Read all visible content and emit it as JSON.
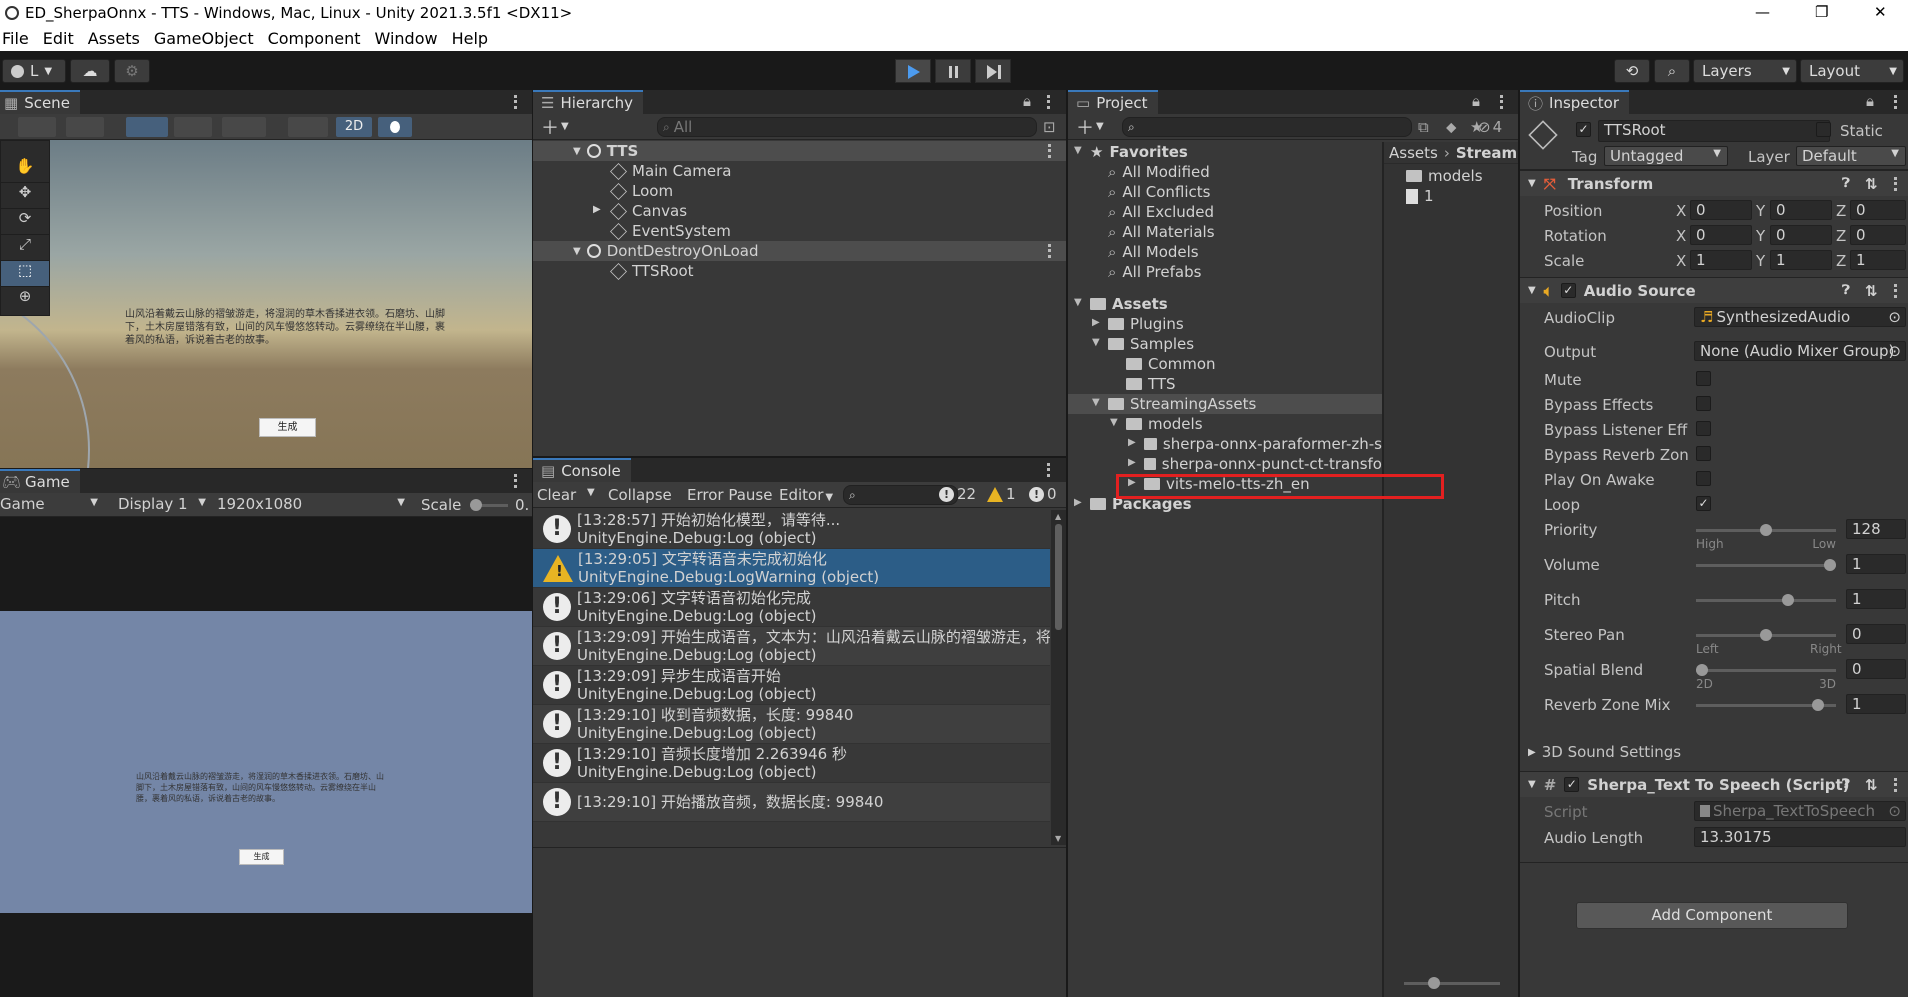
{
  "window": {
    "title": "ED_SherpaOnnx - TTS - Windows, Mac, Linux - Unity 2021.3.5f1 <DX11>",
    "minimize": "—",
    "restore": "❐",
    "close": "✕"
  },
  "menu": [
    "File",
    "Edit",
    "Assets",
    "GameObject",
    "Component",
    "Window",
    "Help"
  ],
  "toolbar": {
    "account": "L",
    "layers": "Layers",
    "layout": "Layout",
    "play": "play-icon",
    "pause": "pause-icon",
    "step": "step-icon"
  },
  "scene": {
    "tab": "Scene",
    "mode_2d": "2D",
    "text": "山风沿着戴云山脉的褶皱游走，将湿润的草木香揉进衣领。石磨坊、山脚下，土木房屋错落有致，山间的风车慢悠悠转动。云雾缭绕在半山腰，裹着风的私语，诉说着古老的故事。",
    "button": "生成"
  },
  "game": {
    "tab": "Game",
    "view": "Game",
    "display": "Display 1",
    "resolution": "1920x1080",
    "scale_label": "Scale",
    "scale_value": "0.",
    "text": "山风沿着戴云山脉的褶皱游走，将湿润的草木香揉进衣领。石磨坊、山脚下，土木房屋错落有致，山间的风车慢悠悠转动。云雾缭绕在半山腰，裹着风的私语，诉说着古老的故事。",
    "button": "生成"
  },
  "hierarchy": {
    "tab": "Hierarchy",
    "search_placeholder": "All",
    "items": [
      {
        "label": "TTS",
        "indent": 0,
        "kind": "scene"
      },
      {
        "label": "Main Camera",
        "indent": 1,
        "kind": "obj"
      },
      {
        "label": "Loom",
        "indent": 1,
        "kind": "obj"
      },
      {
        "label": "Canvas",
        "indent": 1,
        "kind": "obj"
      },
      {
        "label": "EventSystem",
        "indent": 1,
        "kind": "obj"
      },
      {
        "label": "DontDestroyOnLoad",
        "indent": 0,
        "kind": "scene"
      },
      {
        "label": "TTSRoot",
        "indent": 1,
        "kind": "obj"
      }
    ]
  },
  "console": {
    "tab": "Console",
    "clear": "Clear",
    "collapse": "Collapse",
    "error_pause": "Error Pause",
    "editor": "Editor",
    "count_log": "22",
    "count_warn": "1",
    "count_err": "0",
    "entries": [
      {
        "type": "log",
        "line1": "[13:28:57] 开始初始化模型，请等待...",
        "line2": "UnityEngine.Debug:Log (object)"
      },
      {
        "type": "warn",
        "line1": "[13:29:05] 文字转语音未完成初始化",
        "line2": "UnityEngine.Debug:LogWarning (object)"
      },
      {
        "type": "log",
        "line1": "[13:29:06] 文字转语音初始化完成",
        "line2": "UnityEngine.Debug:Log (object)"
      },
      {
        "type": "log",
        "line1": "[13:29:09] 开始生成语音，文本为：山风沿着戴云山脉的褶皱游走，将",
        "line2": "UnityEngine.Debug:Log (object)"
      },
      {
        "type": "log",
        "line1": "[13:29:09] 异步生成语音开始",
        "line2": "UnityEngine.Debug:Log (object)"
      },
      {
        "type": "log",
        "line1": "[13:29:10] 收到音频数据，长度: 99840",
        "line2": "UnityEngine.Debug:Log (object)"
      },
      {
        "type": "log",
        "line1": "[13:29:10] 音频长度增加 2.263946 秒",
        "line2": "UnityEngine.Debug:Log (object)"
      },
      {
        "type": "log",
        "line1": "[13:29:10] 开始播放音频，数据长度: 99840",
        "line2": ""
      }
    ]
  },
  "project": {
    "tab": "Project",
    "lock_count": "4",
    "breadcrumb": [
      "Assets",
      "Streami"
    ],
    "tree": [
      {
        "label": "Favorites",
        "indent": 0,
        "bold": true,
        "kind": "star"
      },
      {
        "label": "All Modified",
        "indent": 1,
        "kind": "search"
      },
      {
        "label": "All Conflicts",
        "indent": 1,
        "kind": "search"
      },
      {
        "label": "All Excluded",
        "indent": 1,
        "kind": "search"
      },
      {
        "label": "All Materials",
        "indent": 1,
        "kind": "search"
      },
      {
        "label": "All Models",
        "indent": 1,
        "kind": "search"
      },
      {
        "label": "All Prefabs",
        "indent": 1,
        "kind": "search"
      },
      {
        "label": "",
        "indent": 0,
        "kind": "spacer"
      },
      {
        "label": "Assets",
        "indent": 0,
        "bold": true,
        "kind": "folder"
      },
      {
        "label": "Plugins",
        "indent": 1,
        "kind": "folder"
      },
      {
        "label": "Samples",
        "indent": 1,
        "kind": "folder"
      },
      {
        "label": "Common",
        "indent": 2,
        "kind": "folder"
      },
      {
        "label": "TTS",
        "indent": 2,
        "kind": "folder"
      },
      {
        "label": "StreamingAssets",
        "indent": 1,
        "kind": "folder",
        "sel": true
      },
      {
        "label": "models",
        "indent": 2,
        "kind": "folder"
      },
      {
        "label": "sherpa-onnx-paraformer-zh-s",
        "indent": 3,
        "kind": "folder"
      },
      {
        "label": "sherpa-onnx-punct-ct-transfo",
        "indent": 3,
        "kind": "folder"
      },
      {
        "label": "vits-melo-tts-zh_en",
        "indent": 3,
        "kind": "folder",
        "highlight": true
      },
      {
        "label": "Packages",
        "indent": 0,
        "bold": true,
        "kind": "folder"
      }
    ],
    "right_items": [
      "models",
      "1"
    ]
  },
  "inspector": {
    "tab": "Inspector",
    "object_name": "TTSRoot",
    "static": "Static",
    "tag_label": "Tag",
    "tag": "Untagged",
    "layer_label": "Layer",
    "layer": "Default",
    "transform": {
      "title": "Transform",
      "rows": [
        {
          "label": "Position",
          "x": "0",
          "y": "0",
          "z": "0"
        },
        {
          "label": "Rotation",
          "x": "0",
          "y": "0",
          "z": "0"
        },
        {
          "label": "Scale",
          "x": "1",
          "y": "1",
          "z": "1"
        }
      ]
    },
    "audio": {
      "title": "Audio Source",
      "audioclip_label": "AudioClip",
      "audioclip": "SynthesizedAudio",
      "output_label": "Output",
      "output": "None (Audio Mixer Group)",
      "toggles": [
        {
          "label": "Mute",
          "on": false
        },
        {
          "label": "Bypass Effects",
          "on": false
        },
        {
          "label": "Bypass Listener Effe",
          "on": false
        },
        {
          "label": "Bypass Reverb Zone",
          "on": false
        },
        {
          "label": "Play On Awake",
          "on": false
        },
        {
          "label": "Loop",
          "on": true
        }
      ],
      "sliders": [
        {
          "label": "Priority",
          "value": "128",
          "pos": 0.5,
          "left": "High",
          "right": "Low"
        },
        {
          "label": "Volume",
          "value": "1",
          "pos": 1,
          "left": "",
          "right": ""
        },
        {
          "label": "Pitch",
          "value": "1",
          "pos": 0.67,
          "left": "",
          "right": ""
        },
        {
          "label": "Stereo Pan",
          "value": "0",
          "pos": 0.5,
          "left": "Left",
          "right": "Right"
        },
        {
          "label": "Spatial Blend",
          "value": "0",
          "pos": 0,
          "left": "2D",
          "right": "3D"
        },
        {
          "label": "Reverb Zone Mix",
          "value": "1",
          "pos": 0.91,
          "left": "",
          "right": ""
        }
      ],
      "sound3d": "3D Sound Settings"
    },
    "script": {
      "title": "Sherpa_Text To Speech (Script)",
      "script_label": "Script",
      "script": "Sherpa_TextToSpeech",
      "length_label": "Audio Length",
      "length": "13.30175"
    },
    "add_component": "Add Component"
  }
}
